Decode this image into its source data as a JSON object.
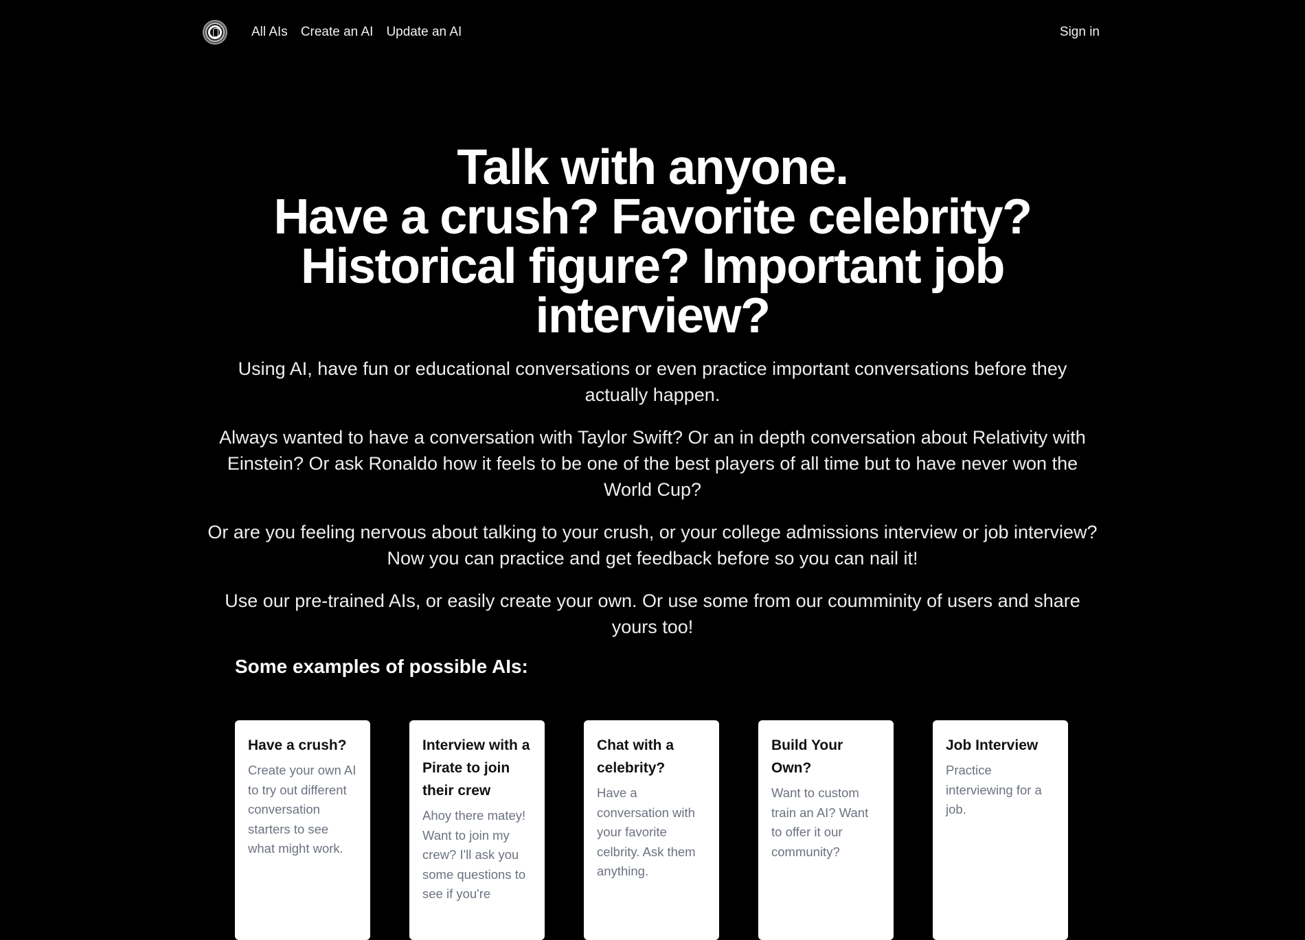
{
  "nav": {
    "logo_icon": "concentric-circles-logo",
    "links": [
      "All AIs",
      "Create an AI",
      "Update an AI"
    ],
    "sign_in": "Sign in"
  },
  "hero": {
    "lines": [
      "Talk with anyone.",
      "Have a crush? Favorite celebrity?",
      "Historical figure? Important job",
      "interview?"
    ]
  },
  "paragraphs": [
    "Using AI, have fun or educational conversations or even practice important conversations before they actually happen.",
    "Always wanted to have a conversation with Taylor Swift? Or an in depth conversation about Relativity with Einstein? Or ask Ronaldo how it feels to be one of the best players of all time but to have never won the World Cup?",
    "Or are you feeling nervous about talking to your crush, or your college admissions interview or job interview? Now you can practice and get feedback before so you can nail it!",
    "Use our pre-trained AIs, or easily create your own. Or use some from our coumminity of users and share yours too!"
  ],
  "examples": {
    "title": "Some examples of possible AIs:",
    "cards": [
      {
        "title": "Have a crush?",
        "description": "Create your own AI to try out different conversation starters to see what might work."
      },
      {
        "title": "Interview with a Pirate to join their crew",
        "description": "Ahoy there matey! Want to join my crew? I'll ask you some questions to see if you're"
      },
      {
        "title": "Chat with a celebrity?",
        "description": "Have a conversation with your favorite celbrity. Ask them anything."
      },
      {
        "title": "Build Your Own?",
        "description": "Want to custom train an AI? Want to offer it our community?"
      },
      {
        "title": "Job Interview",
        "description": "Practice interviewing for a job."
      }
    ]
  }
}
